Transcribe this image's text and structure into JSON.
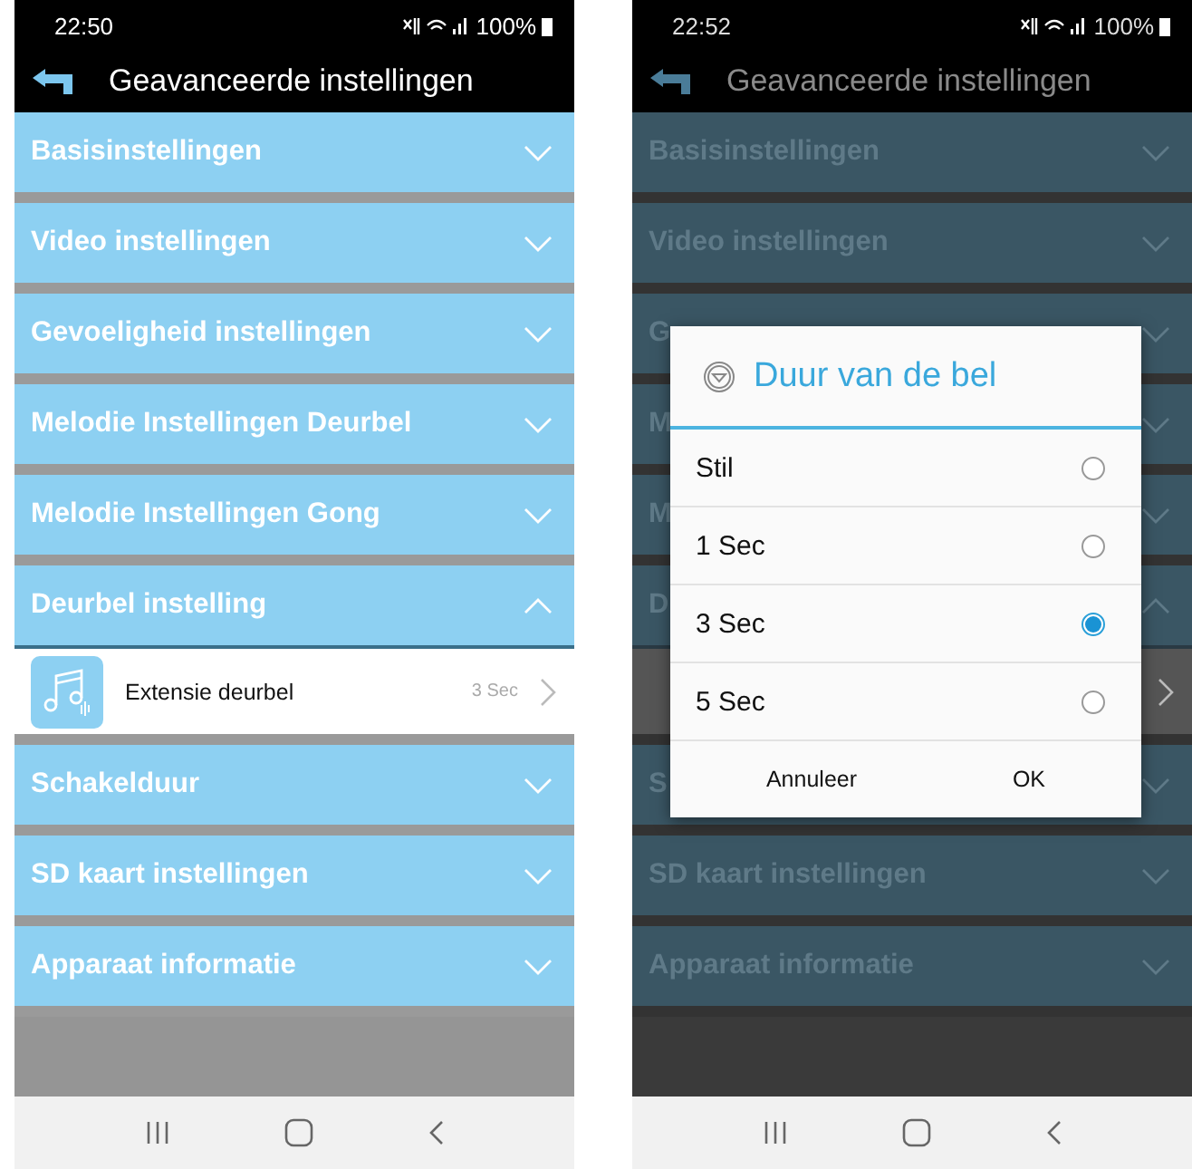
{
  "screens": [
    {
      "status_bar": {
        "time": "22:50",
        "battery": "100%"
      },
      "title": "Geavanceerde instellingen",
      "dimmed": false,
      "sections": [
        {
          "label": "Basisinstellingen",
          "expanded": false
        },
        {
          "label": "Video instellingen",
          "expanded": false
        },
        {
          "label": "Gevoeligheid instellingen",
          "expanded": false
        },
        {
          "label": "Melodie Instellingen Deurbel",
          "expanded": false
        },
        {
          "label": "Melodie Instellingen Gong",
          "expanded": false
        },
        {
          "label": "Deurbel instelling",
          "expanded": true,
          "items": [
            {
              "label": "Extensie deurbel",
              "value": "3 Sec"
            }
          ]
        },
        {
          "label": "Schakelduur",
          "expanded": false
        },
        {
          "label": "SD kaart instellingen",
          "expanded": false
        },
        {
          "label": "Apparaat informatie",
          "expanded": false
        }
      ]
    },
    {
      "status_bar": {
        "time": "22:52",
        "battery": "100%"
      },
      "title": "Geavanceerde instellingen",
      "dimmed": true,
      "sections": [
        {
          "label": "Basisinstellingen",
          "expanded": false
        },
        {
          "label": "Video instellingen",
          "expanded": false
        },
        {
          "label": "G",
          "expanded": false
        },
        {
          "label": "M",
          "expanded": false
        },
        {
          "label": "M",
          "expanded": false
        },
        {
          "label": "D",
          "expanded": true,
          "items": [
            {
              "kind": "covered"
            }
          ]
        },
        {
          "label": "S",
          "expanded": false
        },
        {
          "label": "SD kaart instellingen",
          "expanded": false
        },
        {
          "label": "Apparaat informatie",
          "expanded": false
        }
      ],
      "dialog": {
        "title": "Duur van de bel",
        "options": [
          {
            "label": "Stil",
            "selected": false
          },
          {
            "label": "1 Sec",
            "selected": false
          },
          {
            "label": "3 Sec",
            "selected": true
          },
          {
            "label": "5 Sec",
            "selected": false
          }
        ],
        "buttons": [
          "Annuleer",
          "OK"
        ]
      }
    }
  ]
}
